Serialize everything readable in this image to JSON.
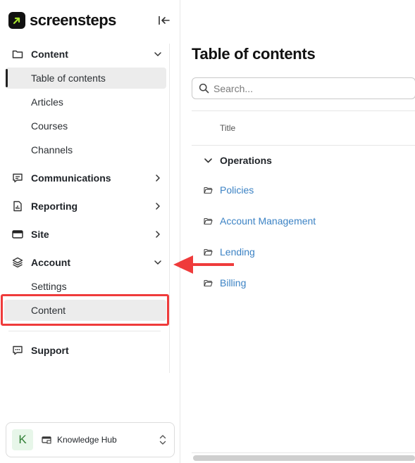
{
  "brand": {
    "name": "screensteps",
    "accent": "#a6e22e"
  },
  "sidebar": {
    "sections": [
      {
        "label": "Content",
        "icon": "folder-icon",
        "expanded": true,
        "items": [
          {
            "label": "Table of contents",
            "active": true
          },
          {
            "label": "Articles"
          },
          {
            "label": "Courses"
          },
          {
            "label": "Channels"
          }
        ]
      },
      {
        "label": "Communications",
        "icon": "chat-icon",
        "expanded": false
      },
      {
        "label": "Reporting",
        "icon": "report-icon",
        "expanded": false
      },
      {
        "label": "Site",
        "icon": "site-icon",
        "expanded": false
      },
      {
        "label": "Account",
        "icon": "layers-icon",
        "expanded": true,
        "items": [
          {
            "label": "Settings"
          },
          {
            "label": "Content",
            "highlighted": true
          }
        ]
      }
    ],
    "support": {
      "label": "Support",
      "icon": "support-chat-icon"
    },
    "workspace": {
      "avatar_letter": "K",
      "label": "Knowledge Hub"
    }
  },
  "main": {
    "title": "Table of contents",
    "search": {
      "placeholder": "Search...",
      "value": ""
    },
    "column_header": "Title",
    "group": {
      "label": "Operations",
      "expanded": true
    },
    "folders": [
      "Policies",
      "Account Management",
      "Lending",
      "Billing"
    ]
  },
  "annotation": {
    "highlight_color": "#ef3b3b",
    "arrow_color": "#ef3b3b"
  }
}
